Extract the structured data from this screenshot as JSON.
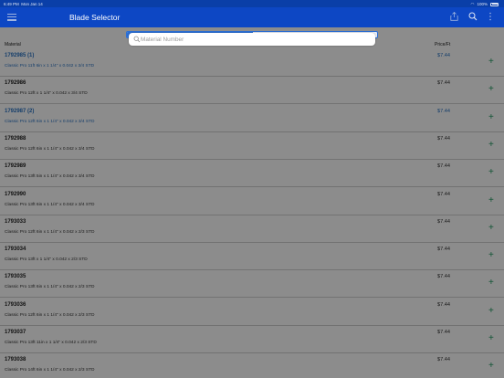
{
  "status": {
    "time": "6:49 PM",
    "date": "Mon Jan 14",
    "battery": "100%"
  },
  "nav": {
    "title": "Blade Selector"
  },
  "search": {
    "placeholder": "Material Number",
    "value": ""
  },
  "columns": {
    "material": "Material",
    "price": "Price/Ft"
  },
  "rows": [
    {
      "num": "1792985 (1)",
      "desc": "Classic Pro 11ft 6in x 1 1/4\" x 0.042 x 3/4 STD",
      "price": "$7.44",
      "highlight": true
    },
    {
      "num": "1792986",
      "desc": "Classic Pro 12ft x 1 1/4\" x 0.042 x 3/4 STD",
      "price": "$7.44",
      "highlight": false
    },
    {
      "num": "1792987 (2)",
      "desc": "Classic Pro 12ft 6in x 1 1/4\" x 0.042 x 3/4 STD",
      "price": "$7.44",
      "highlight": true
    },
    {
      "num": "1792988",
      "desc": "Classic Pro 12ft 6in x 1 1/4\" x 0.042 x 3/4 STD",
      "price": "$7.44",
      "highlight": false
    },
    {
      "num": "1792989",
      "desc": "Classic Pro 13ft 5in x 1 1/4\" x 0.042 x 3/4 STD",
      "price": "$7.44",
      "highlight": false
    },
    {
      "num": "1792990",
      "desc": "Classic Pro 13ft 6in x 1 1/4\" x 0.042 x 3/4 STD",
      "price": "$7.44",
      "highlight": false
    },
    {
      "num": "1793033",
      "desc": "Classic Pro 12ft 6in x 1 1/4\" x 0.042 x 2/3 STD",
      "price": "$7.44",
      "highlight": false
    },
    {
      "num": "1793034",
      "desc": "Classic Pro 13ft x 1 1/4\" x 0.042 x 2/3 STD",
      "price": "$7.44",
      "highlight": false
    },
    {
      "num": "1793035",
      "desc": "Classic Pro 13ft 6in x 1 1/4\" x 0.042 x 2/3 STD",
      "price": "$7.44",
      "highlight": false
    },
    {
      "num": "1793036",
      "desc": "Classic Pro 12ft 6in x 1 1/4\" x 0.042 x 2/3 STD",
      "price": "$7.44",
      "highlight": false
    },
    {
      "num": "1793037",
      "desc": "Classic Pro 13ft 11in x 1 1/4\" x 0.042 x 2/3 STD",
      "price": "$7.44",
      "highlight": false
    },
    {
      "num": "1793038",
      "desc": "Classic Pro 14ft 6in x 1 1/4\" x 0.042 x 2/3 STD",
      "price": "$7.44",
      "highlight": false
    }
  ],
  "icons": {
    "menu": "hamburger-menu-icon",
    "share": "share-icon",
    "search": "search-icon",
    "more": "more-vertical-icon",
    "add": "plus-icon"
  },
  "colors": {
    "nav": "#0d47c4",
    "status": "#0a3fa8",
    "link": "#2b74c4",
    "add": "#1e9a60",
    "segment": "#2b6fd6"
  }
}
